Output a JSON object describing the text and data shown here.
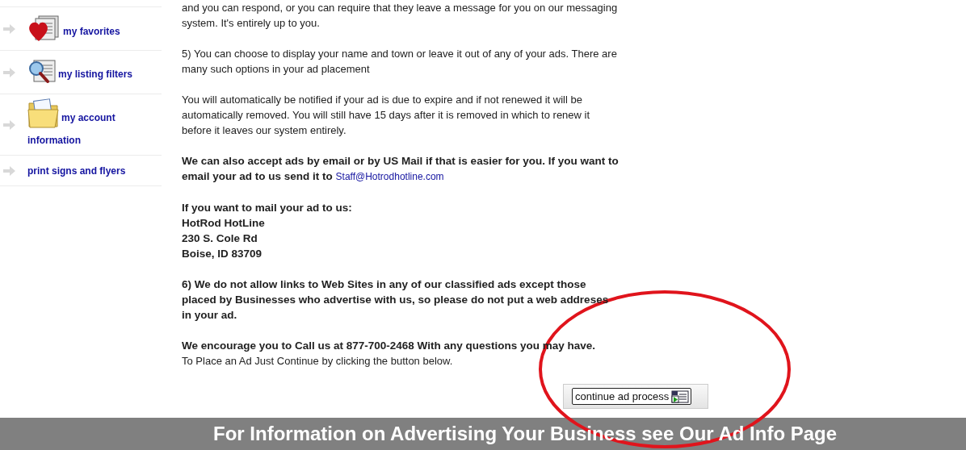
{
  "sidebar": {
    "items": [
      {
        "label": "my favorites"
      },
      {
        "label": "my listing filters"
      },
      {
        "label": "my account information"
      },
      {
        "label": "print signs and flyers"
      }
    ]
  },
  "content": {
    "blocks": [
      {
        "kind": "paragraph",
        "lines": [
          {
            "text": "and you can respond, or you can require that they leave a message for you on our messaging system. It's entirely up to you.",
            "bold": false
          }
        ]
      },
      {
        "kind": "paragraph",
        "lines": [
          {
            "text": "5) You can choose to display your name and town or leave it out of any of your ads. There are many such options in your ad placement",
            "bold": false
          }
        ]
      },
      {
        "kind": "paragraph",
        "lines": [
          {
            "text": "You will automatically be notified if your ad is due to expire and if not renewed it will be automatically removed. You will still have 15 days after it is removed in which to renew it before it leaves our system entirely.",
            "bold": false
          }
        ]
      },
      {
        "kind": "paragraph",
        "lines": [
          {
            "text": "We can also accept ads by email or by US Mail if that is easier for you. If you want to email your ad to us send it to",
            "bold": true,
            "link": "Staff@Hotrodhotline.com"
          }
        ]
      },
      {
        "kind": "paragraph",
        "lines": [
          {
            "text": "If you want to mail your ad to us:",
            "bold": true
          },
          {
            "text": "HotRod HotLine",
            "bold": true
          },
          {
            "text": "230 S. Cole Rd",
            "bold": true
          },
          {
            "text": "Boise, ID 83709",
            "bold": true
          }
        ]
      },
      {
        "kind": "paragraph",
        "lines": [
          {
            "text": "6) We do not allow links to Web Sites in any of our classified ads except those placed by Businesses who advertise with us, so please do not put a web addreses in your ad.",
            "bold": true
          }
        ]
      },
      {
        "kind": "paragraph",
        "lines": [
          {
            "text": "We encourage you to Call us at 877-700-2468 With any questions you may have.",
            "bold": true
          },
          {
            "text": "To Place an Ad Just Continue by clicking the button below.",
            "bold": false
          }
        ]
      }
    ],
    "button": {
      "label": "continue ad process"
    }
  },
  "footer": {
    "text": "For Information on Advertising Your Business see Our Ad Info Page"
  },
  "annotation": {
    "kind": "ellipse"
  }
}
